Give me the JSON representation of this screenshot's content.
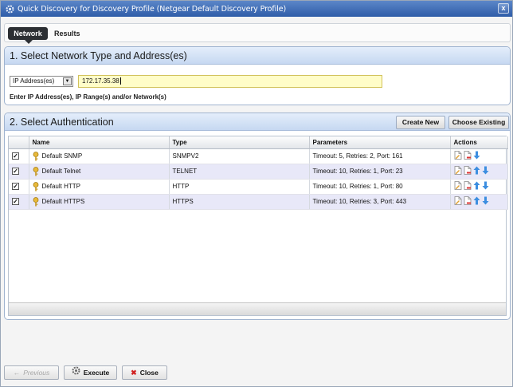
{
  "window": {
    "title": "Quick Discovery for Discovery Profile (Netgear Default Discovery Profile)",
    "close_label": "x"
  },
  "tabs": [
    {
      "label": "Network"
    },
    {
      "label": "Results"
    }
  ],
  "section1": {
    "title": "1. Select Network Type and Address(es)",
    "type_select": "IP Address(es)",
    "address_value": "172.17.35.38",
    "hint": "Enter IP Address(es), IP Range(s) and/or Network(s)"
  },
  "section2": {
    "title": "2. Select Authentication",
    "create_new": "Create New",
    "choose_existing": "Choose Existing",
    "columns": [
      "Name",
      "Type",
      "Parameters",
      "Actions"
    ],
    "rows": [
      {
        "checked": true,
        "name": "Default SNMP",
        "type": "SNMPV2",
        "params": "Timeout: 5, Retries: 2, Port: 161"
      },
      {
        "checked": true,
        "name": "Default Telnet",
        "type": "TELNET",
        "params": "Timeout: 10, Retries: 1, Port: 23"
      },
      {
        "checked": true,
        "name": "Default HTTP",
        "type": "HTTP",
        "params": "Timeout: 10, Retries: 1, Port: 80"
      },
      {
        "checked": true,
        "name": "Default HTTPS",
        "type": "HTTPS",
        "params": "Timeout: 10, Retries: 3, Port: 443"
      }
    ]
  },
  "footer": {
    "previous": "Previous",
    "execute": "Execute",
    "close": "Close"
  },
  "colors": {
    "titlebar": "#2f5da8",
    "panel_header": "#c6d8f1",
    "alt_row": "#e8e8f8",
    "input_bg": "#fffdc8"
  }
}
